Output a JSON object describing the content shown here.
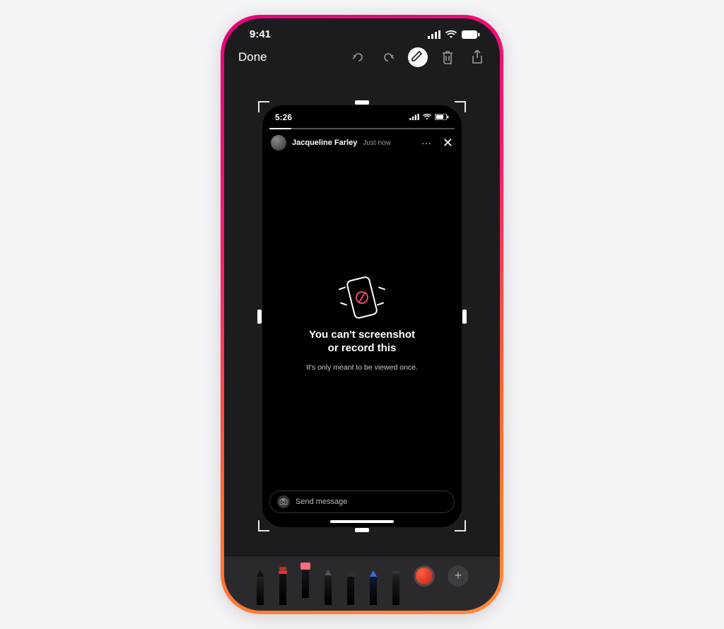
{
  "outer_status": {
    "time": "9:41"
  },
  "toolbar": {
    "done_label": "Done"
  },
  "inner_status": {
    "time": "5:26"
  },
  "story": {
    "username": "Jacqueline Farley",
    "timestamp": "Just now",
    "title_line1": "You can't screenshot",
    "title_line2": "or record this",
    "subtitle": "It's only meant to be viewed once.",
    "send_placeholder": "Send message"
  }
}
